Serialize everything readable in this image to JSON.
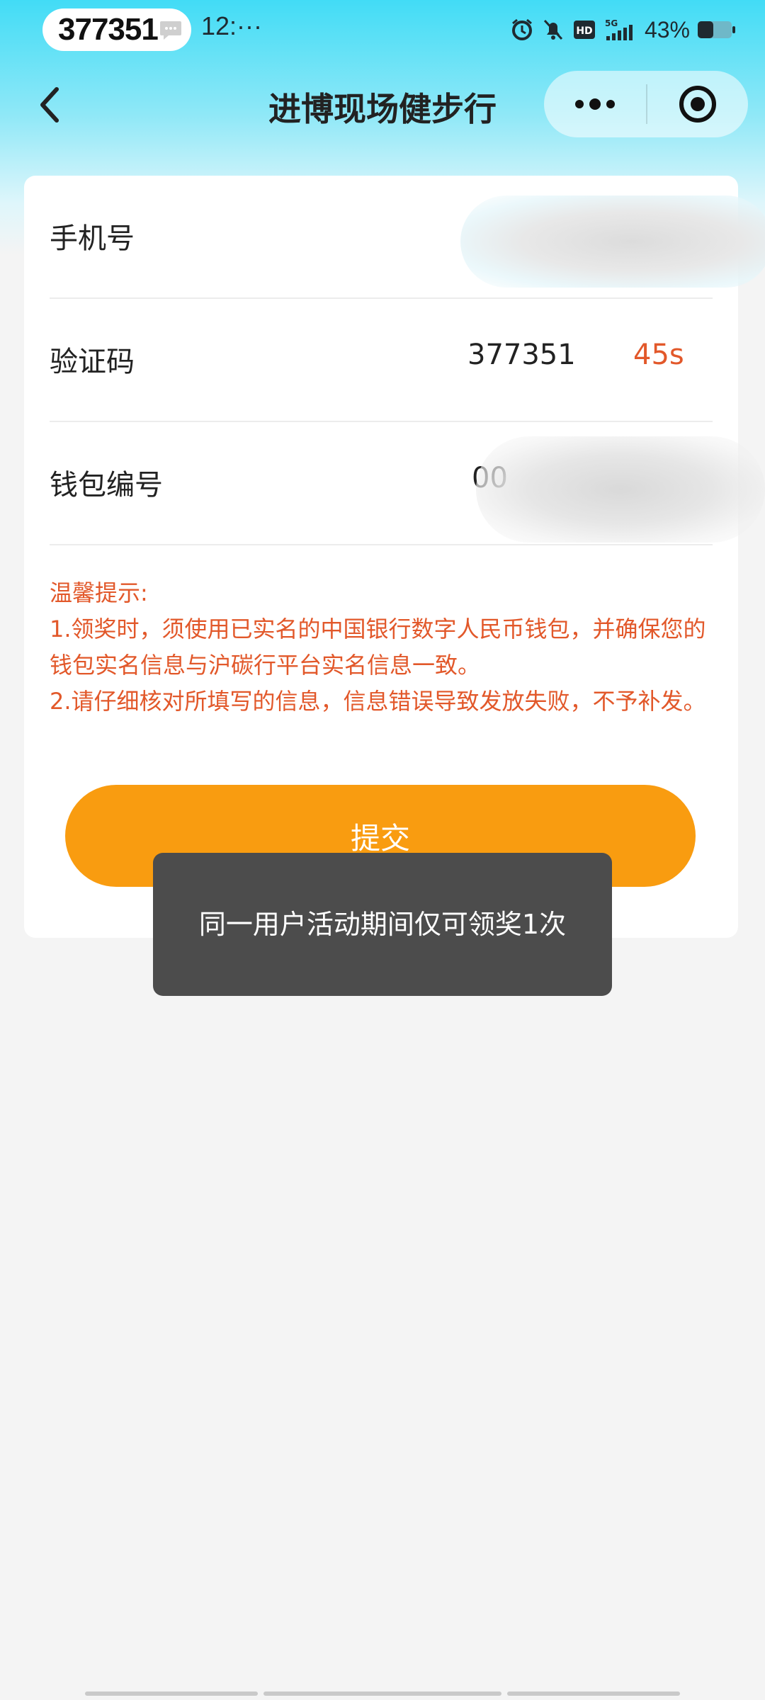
{
  "status_bar": {
    "code_pill": "377351",
    "time": "12:···",
    "battery": "43%",
    "icons": [
      "message-icon",
      "alarm-icon",
      "mute-icon",
      "hd-icon",
      "5g-signal-icon",
      "battery-icon"
    ]
  },
  "nav": {
    "title": "进博现场健步行",
    "icons": [
      "back-icon",
      "more-icon",
      "close-target-icon"
    ]
  },
  "form": {
    "phone": {
      "label": "手机号",
      "value": ""
    },
    "code": {
      "label": "验证码",
      "value": "377351",
      "countdown": "45s"
    },
    "wallet": {
      "label": "钱包编号",
      "value": "00"
    }
  },
  "tips": {
    "title": "温馨提示:",
    "line1": "1.领奖时，须使用已实名的中国银行数字人民币钱包，并确保您的钱包实名信息与沪碳行平台实名信息一致。",
    "line2": "2.请仔细核对所填写的信息，信息错误导致发放失败，不予补发。"
  },
  "submit_label": "提交",
  "toast": "同一用户活动期间仅可领奖1次",
  "colors": {
    "accent_orange": "#f99c10",
    "tip_red": "#e2582a",
    "header_cyan": "#42dcf6",
    "toast_bg": "#4c4c4c"
  }
}
